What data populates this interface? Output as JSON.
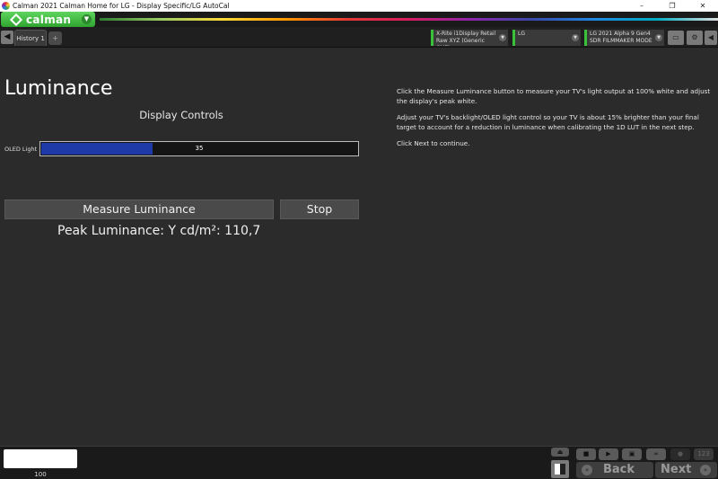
{
  "window": {
    "title": "Calman 2021 Calman Home for LG  - Display Specific/LG AutoCal",
    "controls": [
      "–",
      "❐",
      "✕"
    ]
  },
  "brand": {
    "name": "calman"
  },
  "tabs": [
    {
      "label": "History 1"
    }
  ],
  "devices": {
    "meter": {
      "line1": "X-Rite i1Display Retail",
      "line2": "Raw XYZ (Generic CMF)"
    },
    "source": {
      "line1": "LG",
      "line2": ""
    },
    "display": {
      "line1": "LG 2021 Alpha 9 Gen4",
      "line2": "SDR FILMMAKER MODE"
    }
  },
  "page": {
    "title": "Luminance",
    "section_title": "Display Controls",
    "oled_label": "OLED Light",
    "oled_value": "35",
    "oled_fraction": 0.35,
    "measure_button": "Measure Luminance",
    "stop_button": "Stop",
    "peak_luminance": "Peak Luminance: Y cd/m²: 110,7"
  },
  "instructions": [
    "Click the Measure Luminance button to measure your TV's light output at 100% white and adjust the display's peak white.",
    "Adjust your TV's backlight/OLED light control so your TV is about 15% brighter than your final target to account for a reduction in luminance when calibrating the 1D LUT in the next step.",
    "Click Next to continue."
  ],
  "bottom": {
    "meter_reading": "100",
    "back_label": "Back",
    "next_label": "Next",
    "counter": "123"
  },
  "colors": {
    "accent": "#39c139",
    "slider_fill": "#1e3aa8",
    "background": "#2b2b2b"
  }
}
